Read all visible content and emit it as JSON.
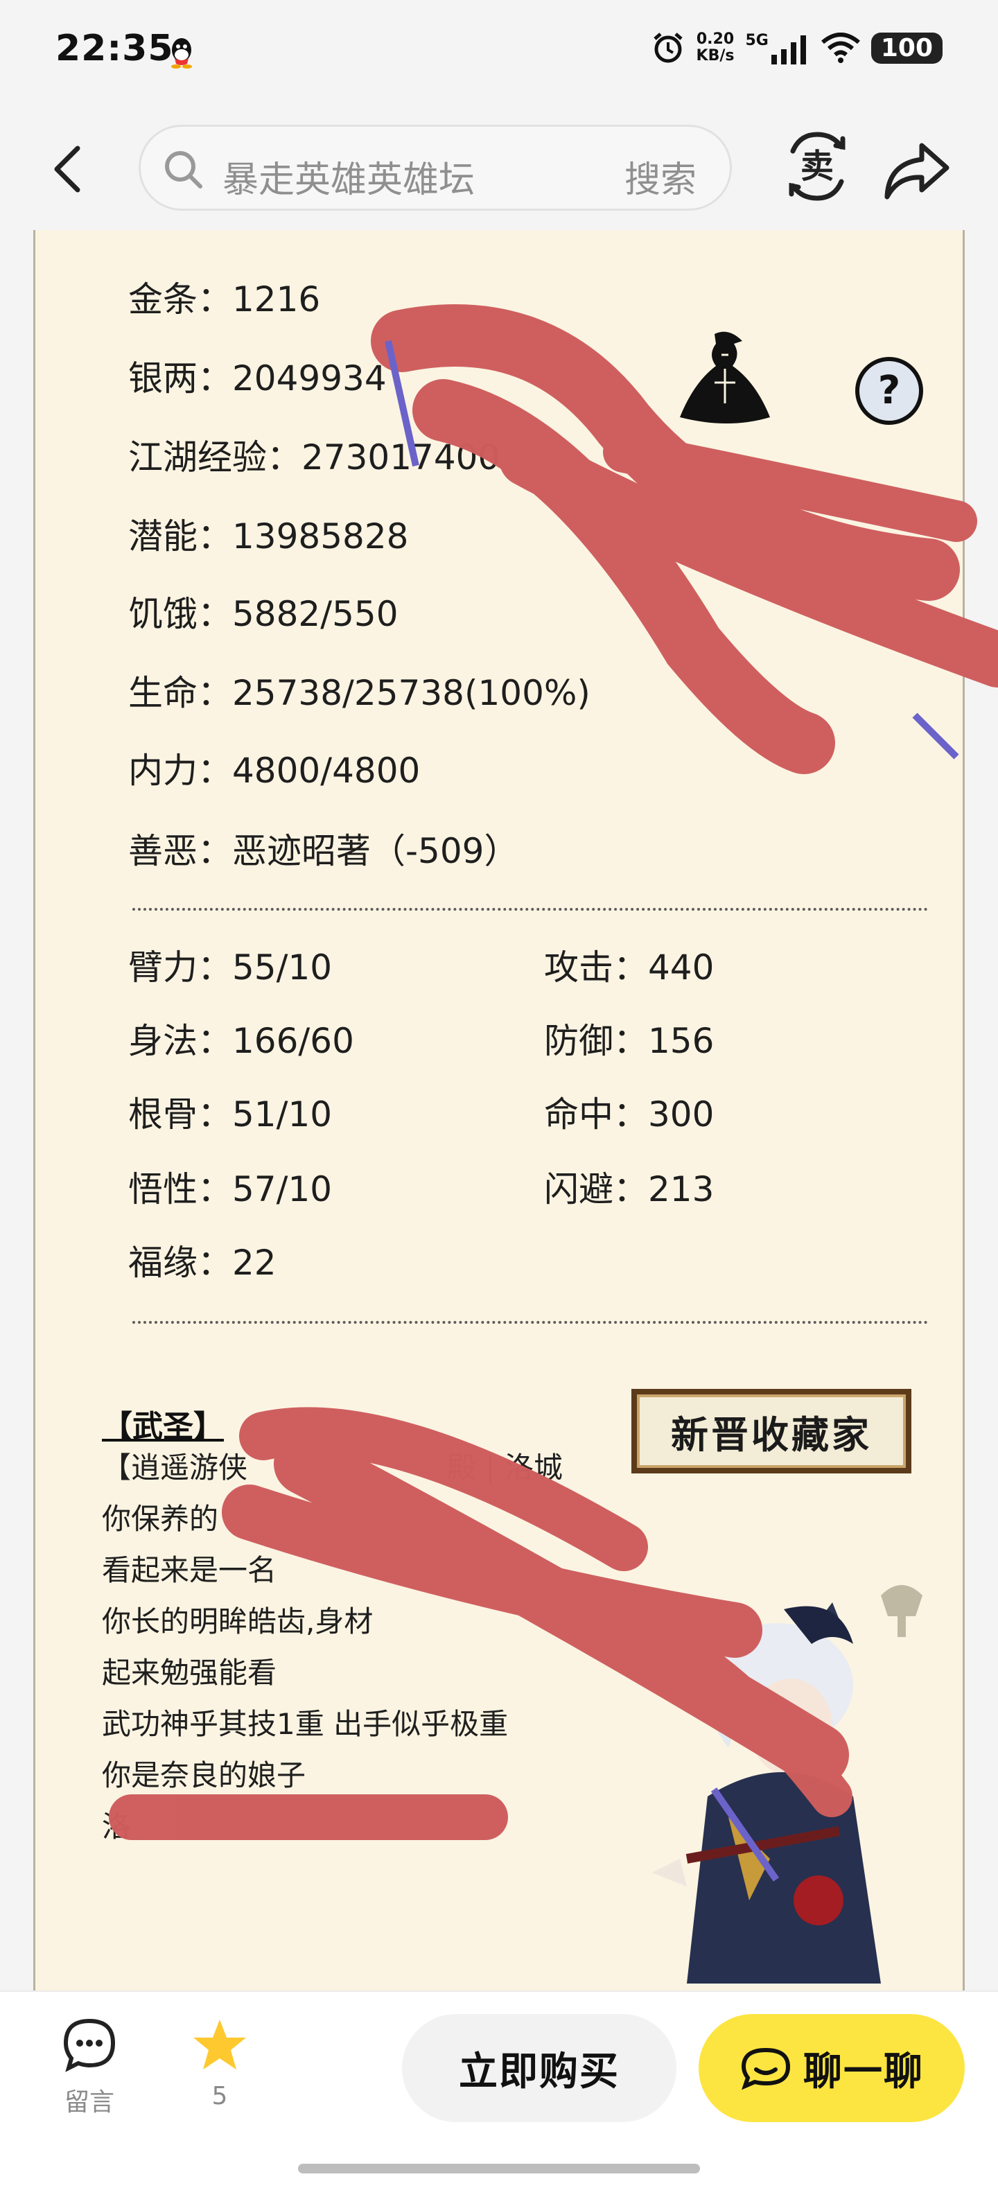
{
  "status": {
    "time": "22:35",
    "speed_value": "0.20",
    "speed_unit": "KB/s",
    "network": "5G",
    "battery": "100"
  },
  "search": {
    "placeholder": "暴走英雄英雄坛",
    "button": "搜索"
  },
  "stats": [
    {
      "label": "金条：",
      "value": "1216"
    },
    {
      "label": "银两：",
      "value": "2049934"
    },
    {
      "label": "江湖经验：",
      "value": "273017400"
    },
    {
      "label": "潜能：",
      "value": "13985828"
    },
    {
      "label": "饥饿：",
      "value": "5882/550"
    },
    {
      "label": "生命：",
      "value": "25738/25738(100%)"
    },
    {
      "label": "内力：",
      "value": "4800/4800"
    },
    {
      "label": "善恶：",
      "value": "恶迹昭著（-509）"
    }
  ],
  "attributes_left": [
    {
      "label": "臂力：",
      "value": "55/10"
    },
    {
      "label": "身法：",
      "value": "166/60"
    },
    {
      "label": "根骨：",
      "value": "51/10"
    },
    {
      "label": "悟性：",
      "value": "57/10"
    },
    {
      "label": "福缘：",
      "value": "22"
    }
  ],
  "attributes_right": [
    {
      "label": "攻击：",
      "value": "440"
    },
    {
      "label": "防御：",
      "value": "156"
    },
    {
      "label": "命中：",
      "value": "300"
    },
    {
      "label": "闪避：",
      "value": "213"
    }
  ],
  "profile": {
    "title": "【武圣】",
    "lines": [
      "【逍遥游侠",
      "殿 | 洛城",
      "你保养的",
      "看起来是一名",
      "你长的明眸皓齿,身材",
      "起来勉强能看",
      "武功神乎其技1重 出手似乎极重",
      "你是奈良的娘子",
      "洛"
    ],
    "stamp": "新晋收藏家"
  },
  "bottom": {
    "comment_label": "留言",
    "star_count": "5",
    "buy_label": "立即购买",
    "chat_label": "聊一聊"
  },
  "colors": {
    "accent_yellow": "#fde541",
    "paper": "#fbf4e2",
    "scribble": "#d05c5c"
  }
}
